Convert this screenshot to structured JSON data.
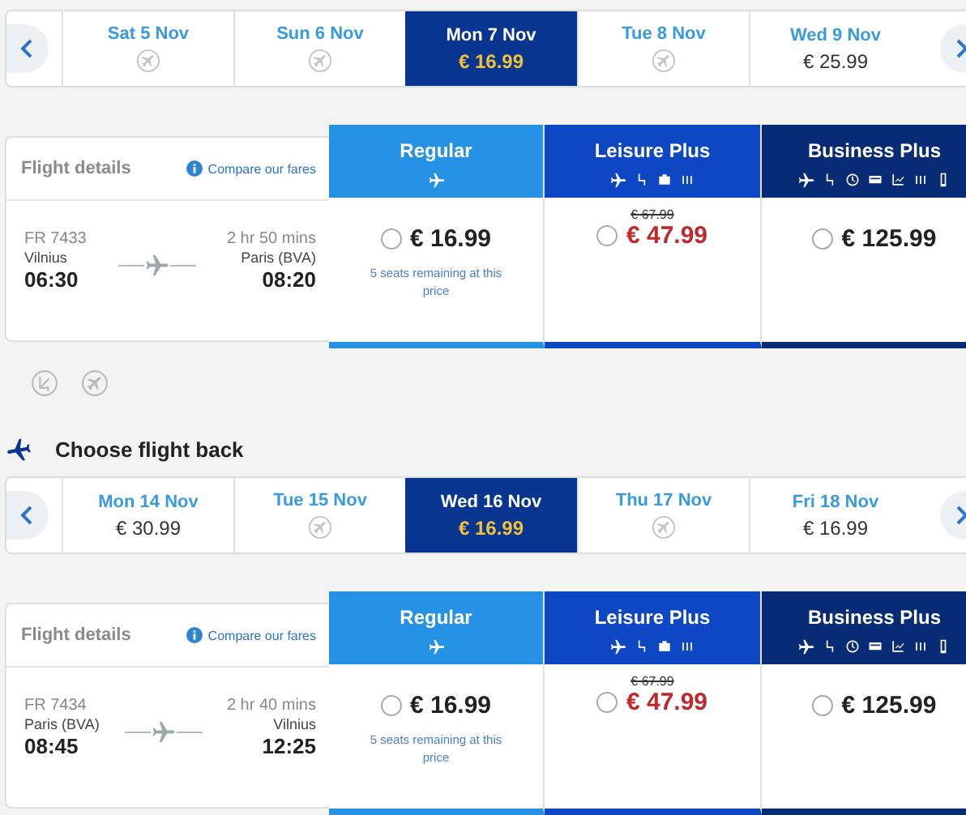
{
  "outbound": {
    "dates": [
      {
        "label": "Sat 5 Nov",
        "selected": false
      },
      {
        "label": "Sun 6 Nov",
        "selected": false
      },
      {
        "label": "Mon 7 Nov",
        "price": "€ 16.99",
        "selected": true
      },
      {
        "label": "Tue 8 Nov",
        "selected": false
      },
      {
        "label": "Wed 9 Nov",
        "price": "€ 25.99",
        "selected": false
      }
    ],
    "details_title": "Flight details",
    "compare_link": "Compare our fares",
    "flight": {
      "number": "FR 7433",
      "from": "Vilnius",
      "depart": "06:30",
      "duration": "2 hr 50 mins",
      "to": "Paris (BVA)",
      "arrive": "08:20"
    },
    "fares": [
      {
        "kind": "regular",
        "name": "Regular",
        "price": "€ 16.99",
        "note": "5 seats remaining at this price",
        "selected": false
      },
      {
        "kind": "leisure",
        "name": "Leisure Plus",
        "old_price": "€ 67.99",
        "price": "€ 47.99",
        "selected": false
      },
      {
        "kind": "business",
        "name": "Business Plus",
        "price": "€ 125.99",
        "selected": false
      }
    ]
  },
  "return_heading": "Choose flight back",
  "return": {
    "dates": [
      {
        "label": "Mon 14 Nov",
        "price": "€ 30.99",
        "selected": false
      },
      {
        "label": "Tue 15 Nov",
        "selected": false
      },
      {
        "label": "Wed 16 Nov",
        "price": "€ 16.99",
        "selected": true
      },
      {
        "label": "Thu 17 Nov",
        "selected": false
      },
      {
        "label": "Fri 18 Nov",
        "price": "€ 16.99",
        "selected": false
      }
    ],
    "details_title": "Flight details",
    "compare_link": "Compare our fares",
    "flight": {
      "number": "FR 7434",
      "from": "Paris (BVA)",
      "depart": "08:45",
      "duration": "2 hr 40 mins",
      "to": "Vilnius",
      "arrive": "12:25"
    },
    "fares": [
      {
        "kind": "regular",
        "name": "Regular",
        "price": "€ 16.99",
        "note": "5 seats remaining at this price",
        "selected": false
      },
      {
        "kind": "leisure",
        "name": "Leisure Plus",
        "old_price": "€ 67.99",
        "price": "€ 47.99",
        "selected": false
      },
      {
        "kind": "business",
        "name": "Business Plus",
        "price": "€ 125.99",
        "selected": false
      }
    ]
  }
}
